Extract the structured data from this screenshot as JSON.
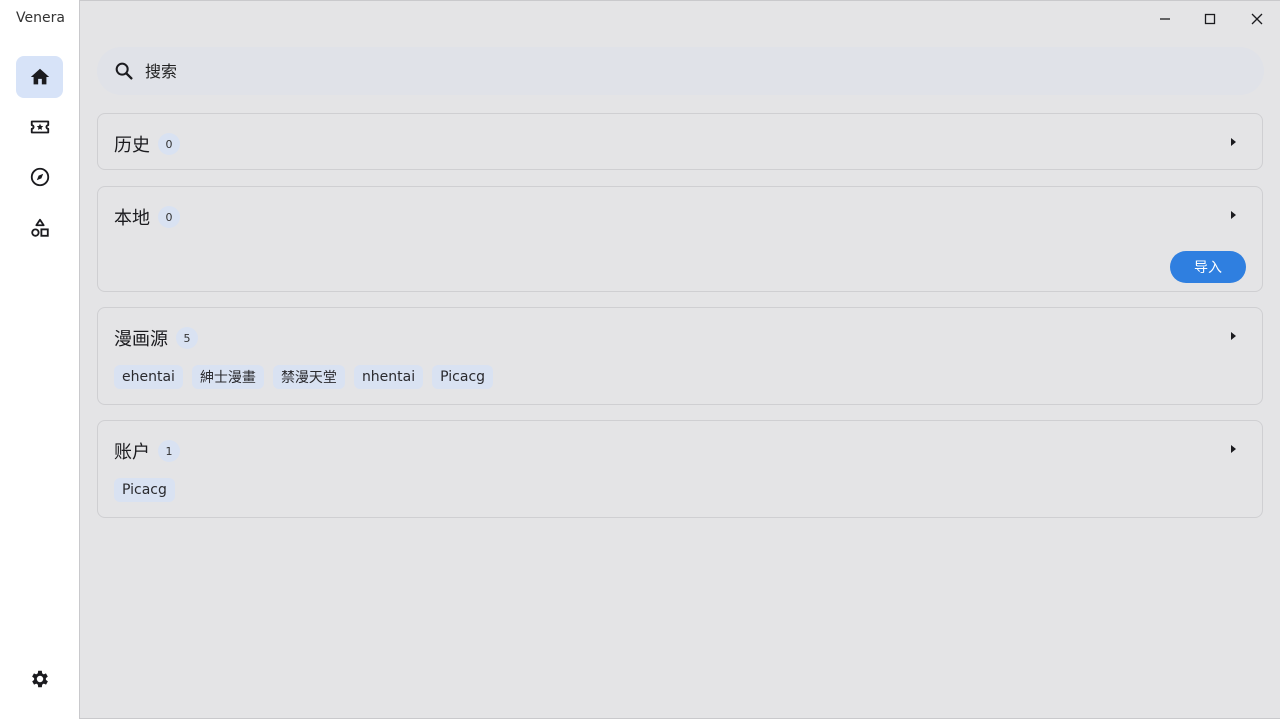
{
  "app": {
    "title": "Venera"
  },
  "search": {
    "placeholder": "搜索"
  },
  "sections": {
    "history": {
      "title": "历史",
      "count": "0"
    },
    "local": {
      "title": "本地",
      "count": "0",
      "import_label": "导入"
    },
    "sources": {
      "title": "漫画源",
      "count": "5",
      "items": [
        "ehentai",
        "紳士漫畫",
        "禁漫天堂",
        "nhentai",
        "Picacg"
      ]
    },
    "accounts": {
      "title": "账户",
      "count": "1",
      "items": [
        "Picacg"
      ]
    }
  },
  "colors": {
    "accent": "#2f7fe0",
    "nav_active": "#d7e3f8",
    "chip": "#d9e2f2",
    "main_bg": "#e4e4e6"
  },
  "icons": {
    "nav": [
      "home-icon",
      "ticket-star-icon",
      "compass-icon",
      "shapes-icon"
    ],
    "settings": "gear-icon",
    "window": [
      "minimize-icon",
      "maximize-icon",
      "close-icon"
    ]
  }
}
